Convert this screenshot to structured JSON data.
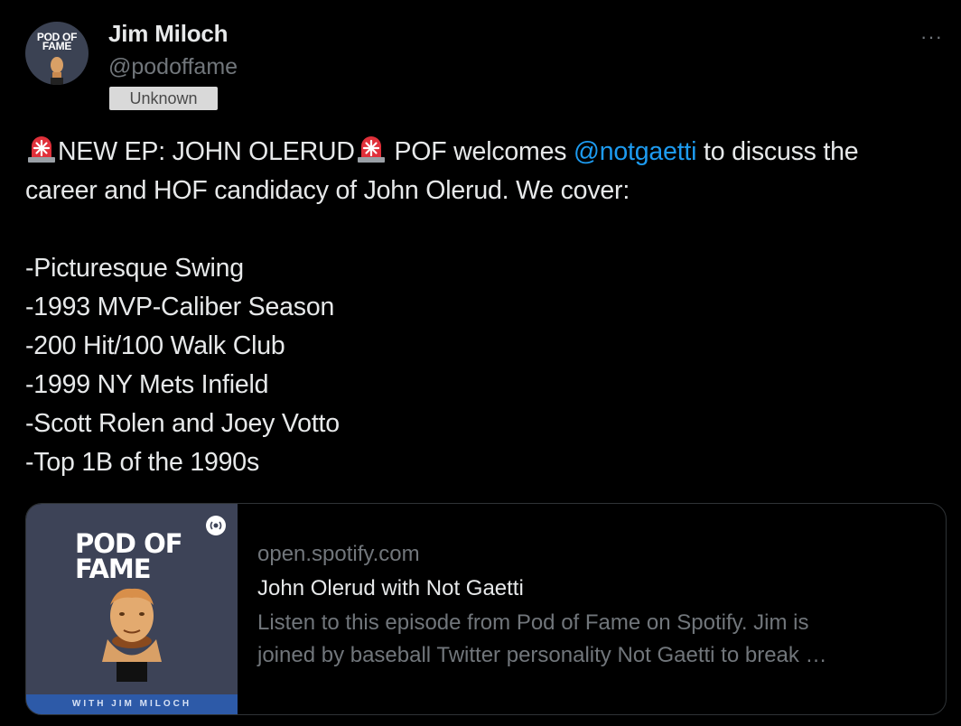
{
  "author": {
    "display_name": "Jim Miloch",
    "handle": "@podoffame",
    "badge": "Unknown",
    "avatar_text": "POD OF FAME"
  },
  "menu": {
    "more_label": "···"
  },
  "tweet": {
    "line1_pre": "NEW EP: JOHN OLERUD",
    "line1_mid": " POF welcomes ",
    "mention": "@notgaetti",
    "line1_post": " to discuss the",
    "line2": "career and HOF candidacy of John Olerud. We cover:",
    "bullets": [
      "-Picturesque Swing",
      "-1993 MVP-Caliber Season",
      "-200 Hit/100 Walk Club",
      "-1999 NY Mets Infield",
      "-Scott Rolen and Joey Votto",
      "-Top 1B of the 1990s"
    ],
    "emoji": "siren-icon"
  },
  "card": {
    "domain": "open.spotify.com",
    "title": "John Olerud with Not Gaetti",
    "description_line1": "Listen to this episode from Pod of Fame on Spotify. Jim is",
    "description_line2": "joined by baseball Twitter personality Not Gaetti to break …",
    "thumb_title": "POD OF FAME",
    "thumb_footer": "WITH JIM MILOCH"
  },
  "colors": {
    "background": "#000000",
    "text": "#e7e9ea",
    "secondary": "#71767b",
    "link": "#1d9bf0",
    "border": "#2f3336",
    "thumb_bg": "#3d4357",
    "thumb_bar": "#2d5aa8"
  }
}
